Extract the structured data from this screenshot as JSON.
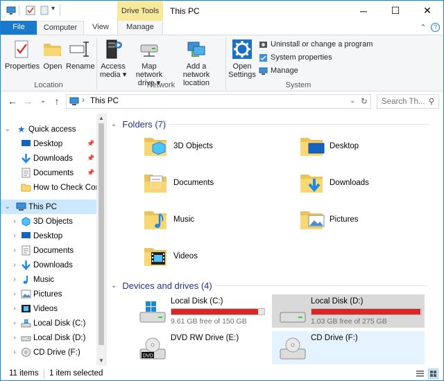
{
  "titlebar": {
    "title": "This PC",
    "context_tab": "Drive Tools",
    "minimize": "─",
    "maximize": "☐",
    "close": "✕"
  },
  "ribbon_tabs": {
    "file": "File",
    "computer": "Computer",
    "view": "View",
    "manage": "Manage",
    "collapse": "⌃",
    "help": "?"
  },
  "ribbon": {
    "location": {
      "label": "Location",
      "properties": "Properties",
      "open": "Open",
      "rename": "Rename"
    },
    "network": {
      "label": "Network",
      "access_media_1": "Access",
      "access_media_2": "media ▾",
      "map_drive_1": "Map network",
      "map_drive_2": "drive ▾",
      "add_location_1": "Add a network",
      "add_location_2": "location"
    },
    "system": {
      "label": "System",
      "open_settings_1": "Open",
      "open_settings_2": "Settings",
      "uninstall": "Uninstall or change a program",
      "sys_props": "System properties",
      "manage": "Manage"
    }
  },
  "address": {
    "back": "←",
    "forward": "→",
    "recent": "⌄",
    "up": "↑",
    "separator": "›",
    "path": "This PC",
    "dropdown": "⌄",
    "refresh": "↻",
    "search_placeholder": "Search Th...",
    "search_icon": "⚲"
  },
  "nav": {
    "quick_access": "Quick access",
    "qa_items": [
      {
        "label": "Desktop",
        "pinned": true
      },
      {
        "label": "Downloads",
        "pinned": true
      },
      {
        "label": "Documents",
        "pinned": true
      },
      {
        "label": "How to Check Com",
        "pinned": false
      }
    ],
    "this_pc": "This PC",
    "pc_items": [
      {
        "label": "3D Objects"
      },
      {
        "label": "Desktop"
      },
      {
        "label": "Documents"
      },
      {
        "label": "Downloads"
      },
      {
        "label": "Music"
      },
      {
        "label": "Pictures"
      },
      {
        "label": "Videos"
      },
      {
        "label": "Local Disk (C:)"
      },
      {
        "label": "Local Disk (D:)"
      },
      {
        "label": "CD Drive (F:)"
      }
    ]
  },
  "content": {
    "folders_header": "Folders (7)",
    "folders": [
      {
        "label": "3D Objects",
        "icon": "3d-objects-folder-icon"
      },
      {
        "label": "Desktop",
        "icon": "desktop-folder-icon"
      },
      {
        "label": "Documents",
        "icon": "documents-folder-icon"
      },
      {
        "label": "Downloads",
        "icon": "downloads-folder-icon"
      },
      {
        "label": "Music",
        "icon": "music-folder-icon"
      },
      {
        "label": "Pictures",
        "icon": "pictures-folder-icon"
      },
      {
        "label": "Videos",
        "icon": "videos-folder-icon"
      }
    ],
    "drives_header": "Devices and drives (4)",
    "drives": [
      {
        "name": "Local Disk (C:)",
        "free": "9.61 GB free of 150 GB",
        "used_fraction": 0.936
      },
      {
        "name": "Local Disk (D:)",
        "free": "1.03 GB free of 275 GB",
        "used_fraction": 0.996
      },
      {
        "name": "DVD RW Drive (E:)"
      },
      {
        "name": "CD Drive (F:)"
      }
    ]
  },
  "status": {
    "items": "11 items",
    "selected": "1 item selected"
  },
  "colors": {
    "accent": "#1979ca",
    "selection": "#cce8ff",
    "drive_bar_full": "#da2626",
    "context_tab": "#f7e99c",
    "header_text": "#1e3287"
  }
}
